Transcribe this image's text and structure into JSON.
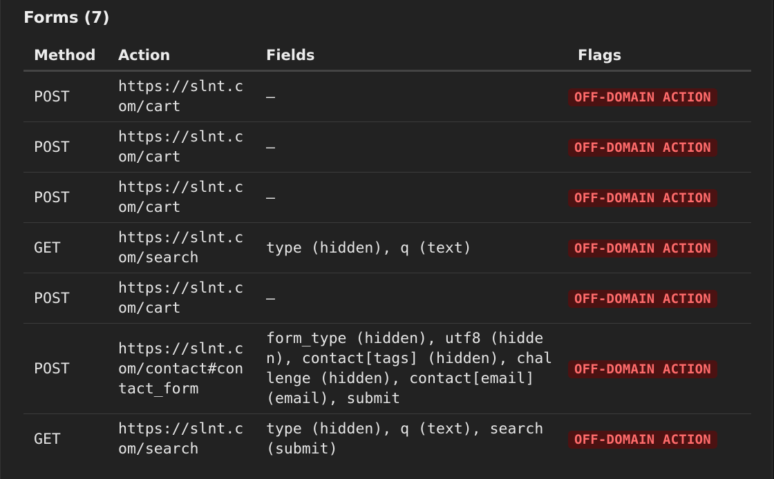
{
  "section": {
    "title": "Forms (7)"
  },
  "table": {
    "headers": {
      "method": "Method",
      "action": "Action",
      "fields": "Fields",
      "flags": "Flags"
    },
    "rows": [
      {
        "method": "POST",
        "action": "https://slnt.com/cart",
        "fields": "—",
        "flag": "OFF-DOMAIN ACTION"
      },
      {
        "method": "POST",
        "action": "https://slnt.com/cart",
        "fields": "—",
        "flag": "OFF-DOMAIN ACTION"
      },
      {
        "method": "POST",
        "action": "https://slnt.com/cart",
        "fields": "—",
        "flag": "OFF-DOMAIN ACTION"
      },
      {
        "method": "GET",
        "action": "https://slnt.com/search",
        "fields": "type (hidden), q (text)",
        "flag": "OFF-DOMAIN ACTION"
      },
      {
        "method": "POST",
        "action": "https://slnt.com/cart",
        "fields": "—",
        "flag": "OFF-DOMAIN ACTION"
      },
      {
        "method": "POST",
        "action": "https://slnt.com/contact#contact_form",
        "fields": "form_type (hidden), utf8 (hidden), contact[tags] (hidden), challenge (hidden), contact[email] (email), submit",
        "flag": "OFF-DOMAIN ACTION"
      },
      {
        "method": "GET",
        "action": "https://slnt.com/search",
        "fields": "type (hidden), q (text), search (submit)",
        "flag": "OFF-DOMAIN ACTION"
      }
    ]
  },
  "colors": {
    "background": "#222222",
    "flag_text": "#ff6b6b",
    "flag_background": "#4b1212"
  }
}
